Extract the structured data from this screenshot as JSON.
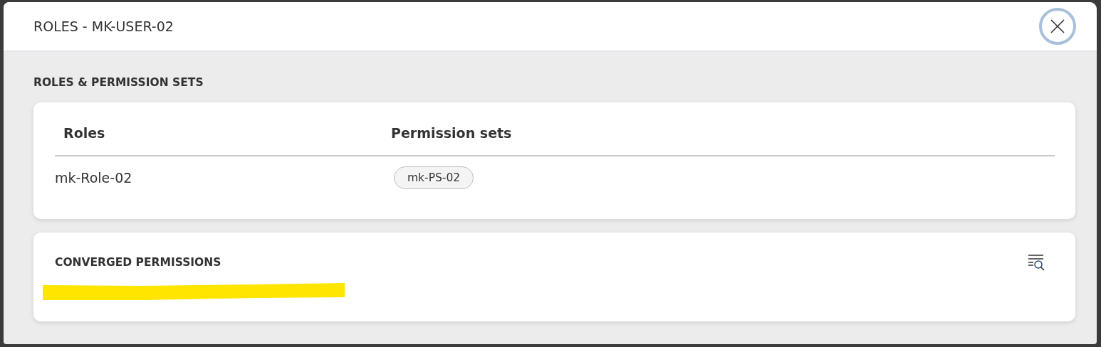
{
  "window": {
    "title": "ROLES - MK-USER-02"
  },
  "roles_section": {
    "title": "ROLES & PERMISSION SETS",
    "columns": [
      "Roles",
      "Permission sets"
    ],
    "rows": [
      {
        "role": "mk-Role-02",
        "permission_sets": [
          "mk-PS-02"
        ]
      }
    ]
  },
  "converged_section": {
    "title": "CONVERGED PERMISSIONS"
  }
}
